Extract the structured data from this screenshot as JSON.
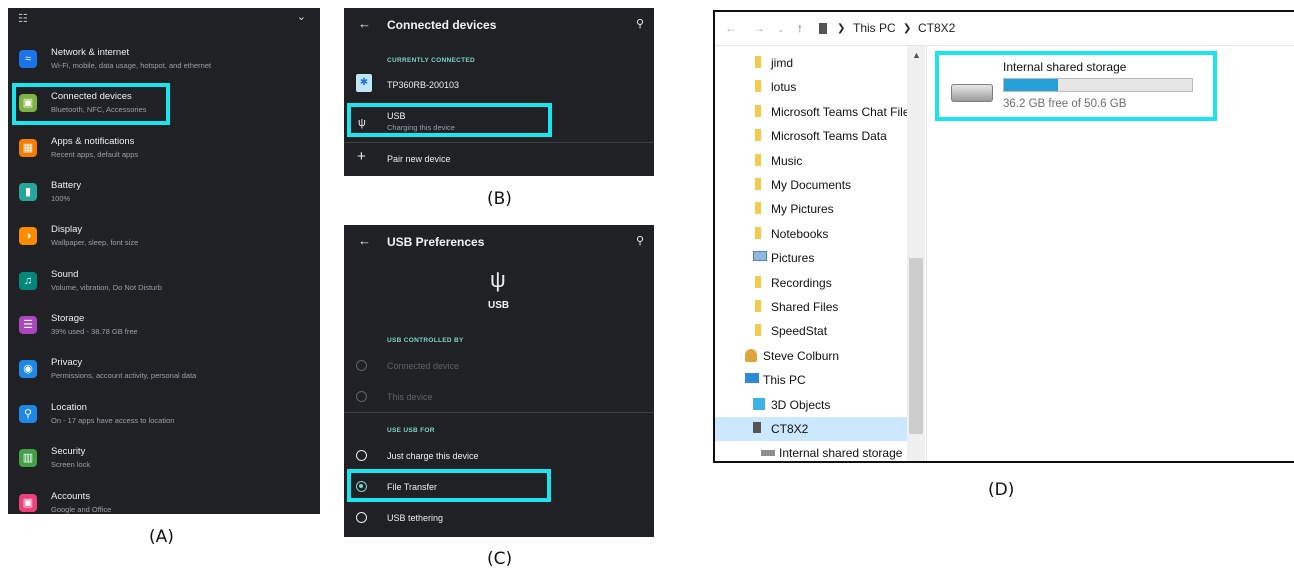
{
  "captions": {
    "a": "(A)",
    "b": "(B)",
    "c": "(C)",
    "d": "(D)"
  },
  "colors": {
    "highlight": "#1ae5ee",
    "accent": "#7fd1c9",
    "progress": "#26a0da"
  },
  "panel_a": {
    "items": [
      {
        "title": "Network & internet",
        "subtitle": "Wi-Fi, mobile, data usage, hotspot, and ethernet",
        "icon": "wifi-icon",
        "color": "#1a73e8"
      },
      {
        "title": "Connected devices",
        "subtitle": "Bluetooth, NFC, Accessories",
        "icon": "devices-icon",
        "color": "#7cb342"
      },
      {
        "title": "Apps & notifications",
        "subtitle": "Recent apps, default apps",
        "icon": "apps-icon",
        "color": "#f57c00"
      },
      {
        "title": "Battery",
        "subtitle": "100%",
        "icon": "battery-icon",
        "color": "#26a69a"
      },
      {
        "title": "Display",
        "subtitle": "Wallpaper, sleep, font size",
        "icon": "display-icon",
        "color": "#fb8c00"
      },
      {
        "title": "Sound",
        "subtitle": "Volume, vibration, Do Not Disturb",
        "icon": "sound-icon",
        "color": "#00897b"
      },
      {
        "title": "Storage",
        "subtitle": "39% used - 38.78 GB free",
        "icon": "storage-icon",
        "color": "#ab47bc"
      },
      {
        "title": "Privacy",
        "subtitle": "Permissions, account activity, personal data",
        "icon": "privacy-icon",
        "color": "#1e88e5"
      },
      {
        "title": "Location",
        "subtitle": "On - 17 apps have access to location",
        "icon": "location-icon",
        "color": "#1e88e5"
      },
      {
        "title": "Security",
        "subtitle": "Screen lock",
        "icon": "lock-icon",
        "color": "#43a047"
      },
      {
        "title": "Accounts",
        "subtitle": "Google and Office",
        "icon": "accounts-icon",
        "color": "#ec407a"
      }
    ]
  },
  "panel_b": {
    "title": "Connected devices",
    "section": "CURRENTLY CONNECTED",
    "bt_device": "TP360RB-200103",
    "usb_title": "USB",
    "usb_sub": "Charging this device",
    "pair": "Pair new device"
  },
  "panel_c": {
    "title": "USB Preferences",
    "usb_label": "USB",
    "section1": "USB CONTROLLED BY",
    "opt_connected": "Connected device",
    "opt_this": "This device",
    "section2": "USE USB FOR",
    "opt_charge": "Just charge this device",
    "opt_transfer": "File Transfer",
    "opt_tether": "USB tethering"
  },
  "panel_d": {
    "breadcrumb": [
      "This PC",
      "CT8X2"
    ],
    "nav": [
      "jimd",
      "lotus",
      "Microsoft Teams Chat File",
      "Microsoft Teams Data",
      "Music",
      "My Documents",
      "My Pictures",
      "Notebooks",
      "Pictures",
      "Recordings",
      "Shared Files",
      "SpeedStat",
      "Steve Colburn",
      "This PC",
      "3D Objects",
      "CT8X2",
      "Internal shared storage"
    ],
    "drive_name": "Internal shared storage",
    "drive_free": "36.2 GB free of 50.6 GB",
    "used_fraction": 0.285
  }
}
